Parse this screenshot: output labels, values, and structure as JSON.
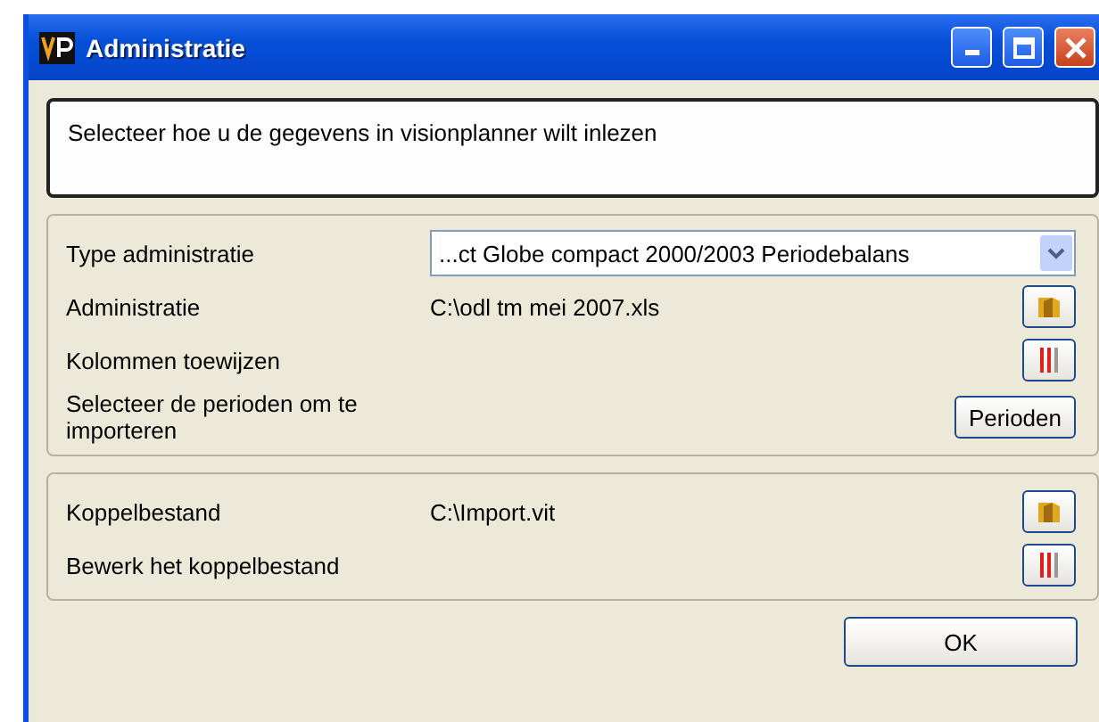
{
  "window": {
    "title": "Administratie"
  },
  "instruction": "Selecteer hoe u de gegevens in visionplanner wilt inlezen",
  "groups": [
    {
      "rows": [
        {
          "label": "Type administratie",
          "kind": "select",
          "value": "...ct Globe compact 2000/2003 Periodebalans"
        },
        {
          "label": "Administratie",
          "kind": "file",
          "value": "C:\\odl tm mei 2007.xls"
        },
        {
          "label": "Kolommen toewijzen",
          "kind": "edit"
        },
        {
          "label": "Selecteer de perioden om te importeren",
          "kind": "button",
          "button": "Perioden"
        }
      ]
    },
    {
      "rows": [
        {
          "label": "Koppelbestand",
          "kind": "file",
          "value": "C:\\Import.vit"
        },
        {
          "label": "Bewerk het koppelbestand",
          "kind": "edit"
        }
      ]
    }
  ],
  "buttons": [
    "OK"
  ]
}
